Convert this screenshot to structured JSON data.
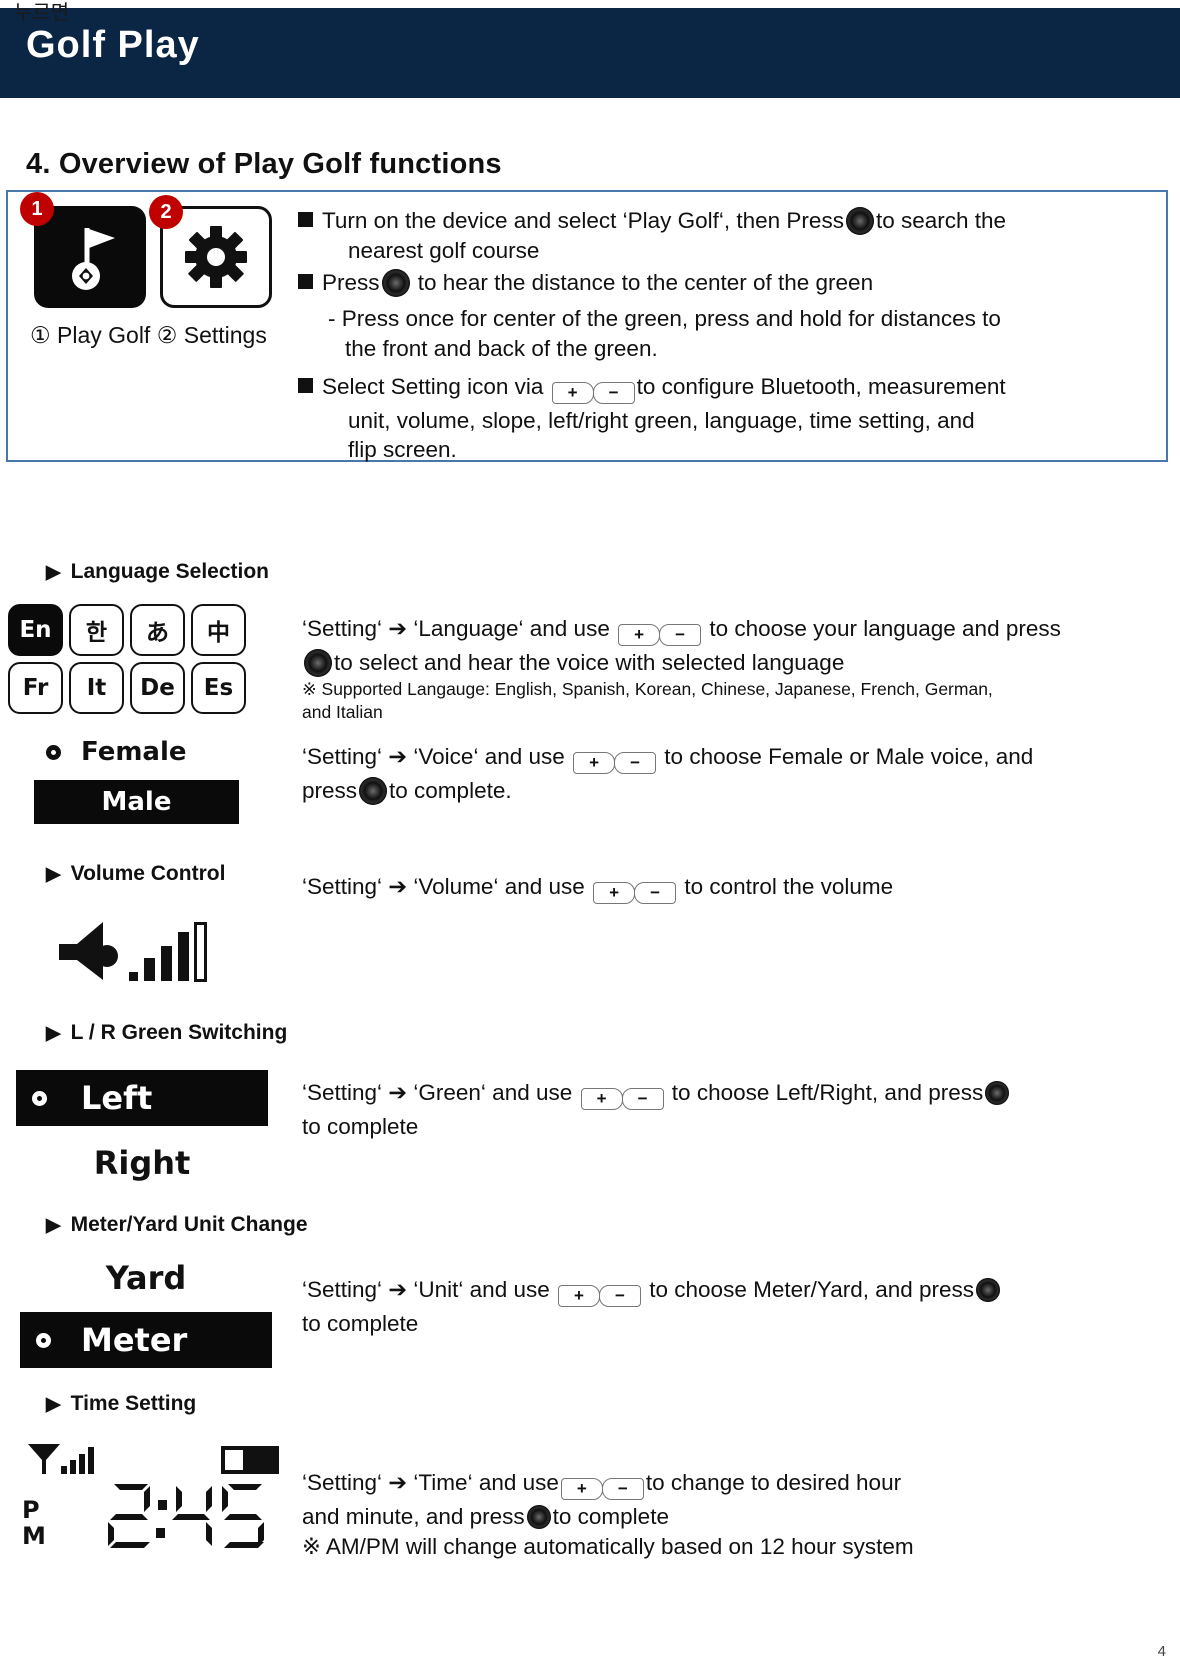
{
  "header": {
    "korean_tag": "누르면",
    "title": "Golf Play"
  },
  "section": {
    "title": "4. Overview of Play Golf functions"
  },
  "overview": {
    "badges": [
      "1",
      "2"
    ],
    "tile_caption": "① Play Golf ② Settings",
    "icons": {
      "play_golf": "golf-flag-icon",
      "settings": "gear-icon"
    },
    "bullets": [
      {
        "line1_a": "Turn on the device and select ‘Play Golf‘, then Press",
        "line1_b": "to search the",
        "line2": "nearest golf course"
      },
      {
        "line1_a": "Press",
        "line1_b": "to hear the distance to the center of the green",
        "sub1": "- Press once for center of the green, press and hold for distances to",
        "sub2": "the front and back of the green."
      },
      {
        "line1_a": "Select Setting icon via",
        "line1_b": "to configure Bluetooth, measurement",
        "line2": "unit, volume, slope, left/right green, language, time setting, and",
        "line3": "flip screen."
      }
    ]
  },
  "keys": {
    "plus": "+",
    "minus": "−"
  },
  "language": {
    "heading": "Language Selection",
    "tiles": [
      {
        "label": "En",
        "selected": true
      },
      {
        "label": "한",
        "selected": false
      },
      {
        "label": "あ",
        "selected": false
      },
      {
        "label": "中",
        "selected": false
      },
      {
        "label": "Fr",
        "selected": false
      },
      {
        "label": "It",
        "selected": false
      },
      {
        "label": "De",
        "selected": false
      },
      {
        "label": "Es",
        "selected": false
      }
    ],
    "desc_a": "‘Setting‘ ➔ ‘Language‘ and use",
    "desc_b": "to choose your language and",
    "desc_c": "press",
    "desc_d": "to select and hear the voice with selected language",
    "note1": "※ Supported Langauge: English, Spanish, Korean, Chinese, Japanese, French, German,",
    "note2": "and Italian"
  },
  "voice": {
    "options": [
      {
        "label": "Female",
        "selected": false
      },
      {
        "label": "Male",
        "selected": true
      }
    ],
    "desc_a": "‘Setting‘ ➔ ‘Voice‘ and use",
    "desc_b": "to choose Female or Male voice, and",
    "desc_c": "press",
    "desc_d": "to complete."
  },
  "volume": {
    "heading": "Volume Control",
    "icon": "speaker-volume-bars-icon",
    "desc_a": "‘Setting‘ ➔ ‘Volume‘ and use",
    "desc_b": "to control the volume"
  },
  "green": {
    "heading": "L / R Green Switching",
    "options": [
      {
        "label": "Left",
        "selected": true
      },
      {
        "label": "Right",
        "selected": false
      }
    ],
    "desc_a": "‘Setting‘ ➔ ‘Green‘ and use",
    "desc_b": "to choose Left/Right, and press",
    "desc_c": "to complete"
  },
  "unit": {
    "heading": "Meter/Yard Unit Change",
    "options": [
      {
        "label": "Yard",
        "selected": false
      },
      {
        "label": "Meter",
        "selected": true
      }
    ],
    "desc_a": "‘Setting‘ ➔ ‘Unit‘ and use",
    "desc_b": "to choose Meter/Yard, and press",
    "desc_c": "to complete"
  },
  "time": {
    "heading": "Time Setting",
    "clock": {
      "value": "2:45",
      "meridiem_top": "P",
      "meridiem_bottom": "M",
      "signal": "signal-bars-icon",
      "battery": "battery-icon"
    },
    "desc_a": "‘Setting‘ ➔ ‘Time‘ and use",
    "desc_b": "to change to desired hour",
    "desc_c": "and minute, and press",
    "desc_d": "to complete",
    "note": "※ AM/PM will change automatically based on 12 hour system"
  },
  "footer": {
    "page_number": "4"
  }
}
